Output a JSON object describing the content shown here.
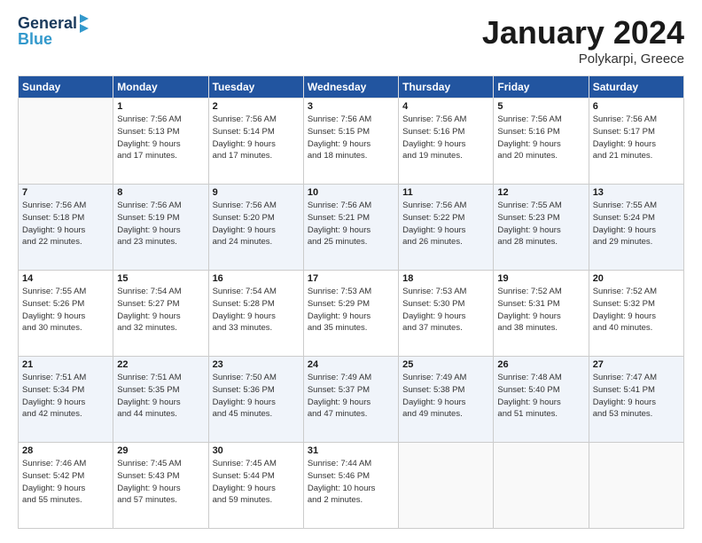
{
  "header": {
    "logo_line1": "General",
    "logo_line2": "Blue",
    "month_title": "January 2024",
    "location": "Polykarpi, Greece"
  },
  "weekdays": [
    "Sunday",
    "Monday",
    "Tuesday",
    "Wednesday",
    "Thursday",
    "Friday",
    "Saturday"
  ],
  "weeks": [
    [
      {
        "day": "",
        "sunrise": "",
        "sunset": "",
        "daylight": ""
      },
      {
        "day": "1",
        "sunrise": "Sunrise: 7:56 AM",
        "sunset": "Sunset: 5:13 PM",
        "daylight": "Daylight: 9 hours and 17 minutes."
      },
      {
        "day": "2",
        "sunrise": "Sunrise: 7:56 AM",
        "sunset": "Sunset: 5:14 PM",
        "daylight": "Daylight: 9 hours and 17 minutes."
      },
      {
        "day": "3",
        "sunrise": "Sunrise: 7:56 AM",
        "sunset": "Sunset: 5:15 PM",
        "daylight": "Daylight: 9 hours and 18 minutes."
      },
      {
        "day": "4",
        "sunrise": "Sunrise: 7:56 AM",
        "sunset": "Sunset: 5:16 PM",
        "daylight": "Daylight: 9 hours and 19 minutes."
      },
      {
        "day": "5",
        "sunrise": "Sunrise: 7:56 AM",
        "sunset": "Sunset: 5:16 PM",
        "daylight": "Daylight: 9 hours and 20 minutes."
      },
      {
        "day": "6",
        "sunrise": "Sunrise: 7:56 AM",
        "sunset": "Sunset: 5:17 PM",
        "daylight": "Daylight: 9 hours and 21 minutes."
      }
    ],
    [
      {
        "day": "7",
        "sunrise": "Sunrise: 7:56 AM",
        "sunset": "Sunset: 5:18 PM",
        "daylight": "Daylight: 9 hours and 22 minutes."
      },
      {
        "day": "8",
        "sunrise": "Sunrise: 7:56 AM",
        "sunset": "Sunset: 5:19 PM",
        "daylight": "Daylight: 9 hours and 23 minutes."
      },
      {
        "day": "9",
        "sunrise": "Sunrise: 7:56 AM",
        "sunset": "Sunset: 5:20 PM",
        "daylight": "Daylight: 9 hours and 24 minutes."
      },
      {
        "day": "10",
        "sunrise": "Sunrise: 7:56 AM",
        "sunset": "Sunset: 5:21 PM",
        "daylight": "Daylight: 9 hours and 25 minutes."
      },
      {
        "day": "11",
        "sunrise": "Sunrise: 7:56 AM",
        "sunset": "Sunset: 5:22 PM",
        "daylight": "Daylight: 9 hours and 26 minutes."
      },
      {
        "day": "12",
        "sunrise": "Sunrise: 7:55 AM",
        "sunset": "Sunset: 5:23 PM",
        "daylight": "Daylight: 9 hours and 28 minutes."
      },
      {
        "day": "13",
        "sunrise": "Sunrise: 7:55 AM",
        "sunset": "Sunset: 5:24 PM",
        "daylight": "Daylight: 9 hours and 29 minutes."
      }
    ],
    [
      {
        "day": "14",
        "sunrise": "Sunrise: 7:55 AM",
        "sunset": "Sunset: 5:26 PM",
        "daylight": "Daylight: 9 hours and 30 minutes."
      },
      {
        "day": "15",
        "sunrise": "Sunrise: 7:54 AM",
        "sunset": "Sunset: 5:27 PM",
        "daylight": "Daylight: 9 hours and 32 minutes."
      },
      {
        "day": "16",
        "sunrise": "Sunrise: 7:54 AM",
        "sunset": "Sunset: 5:28 PM",
        "daylight": "Daylight: 9 hours and 33 minutes."
      },
      {
        "day": "17",
        "sunrise": "Sunrise: 7:53 AM",
        "sunset": "Sunset: 5:29 PM",
        "daylight": "Daylight: 9 hours and 35 minutes."
      },
      {
        "day": "18",
        "sunrise": "Sunrise: 7:53 AM",
        "sunset": "Sunset: 5:30 PM",
        "daylight": "Daylight: 9 hours and 37 minutes."
      },
      {
        "day": "19",
        "sunrise": "Sunrise: 7:52 AM",
        "sunset": "Sunset: 5:31 PM",
        "daylight": "Daylight: 9 hours and 38 minutes."
      },
      {
        "day": "20",
        "sunrise": "Sunrise: 7:52 AM",
        "sunset": "Sunset: 5:32 PM",
        "daylight": "Daylight: 9 hours and 40 minutes."
      }
    ],
    [
      {
        "day": "21",
        "sunrise": "Sunrise: 7:51 AM",
        "sunset": "Sunset: 5:34 PM",
        "daylight": "Daylight: 9 hours and 42 minutes."
      },
      {
        "day": "22",
        "sunrise": "Sunrise: 7:51 AM",
        "sunset": "Sunset: 5:35 PM",
        "daylight": "Daylight: 9 hours and 44 minutes."
      },
      {
        "day": "23",
        "sunrise": "Sunrise: 7:50 AM",
        "sunset": "Sunset: 5:36 PM",
        "daylight": "Daylight: 9 hours and 45 minutes."
      },
      {
        "day": "24",
        "sunrise": "Sunrise: 7:49 AM",
        "sunset": "Sunset: 5:37 PM",
        "daylight": "Daylight: 9 hours and 47 minutes."
      },
      {
        "day": "25",
        "sunrise": "Sunrise: 7:49 AM",
        "sunset": "Sunset: 5:38 PM",
        "daylight": "Daylight: 9 hours and 49 minutes."
      },
      {
        "day": "26",
        "sunrise": "Sunrise: 7:48 AM",
        "sunset": "Sunset: 5:40 PM",
        "daylight": "Daylight: 9 hours and 51 minutes."
      },
      {
        "day": "27",
        "sunrise": "Sunrise: 7:47 AM",
        "sunset": "Sunset: 5:41 PM",
        "daylight": "Daylight: 9 hours and 53 minutes."
      }
    ],
    [
      {
        "day": "28",
        "sunrise": "Sunrise: 7:46 AM",
        "sunset": "Sunset: 5:42 PM",
        "daylight": "Daylight: 9 hours and 55 minutes."
      },
      {
        "day": "29",
        "sunrise": "Sunrise: 7:45 AM",
        "sunset": "Sunset: 5:43 PM",
        "daylight": "Daylight: 9 hours and 57 minutes."
      },
      {
        "day": "30",
        "sunrise": "Sunrise: 7:45 AM",
        "sunset": "Sunset: 5:44 PM",
        "daylight": "Daylight: 9 hours and 59 minutes."
      },
      {
        "day": "31",
        "sunrise": "Sunrise: 7:44 AM",
        "sunset": "Sunset: 5:46 PM",
        "daylight": "Daylight: 10 hours and 2 minutes."
      },
      {
        "day": "",
        "sunrise": "",
        "sunset": "",
        "daylight": ""
      },
      {
        "day": "",
        "sunrise": "",
        "sunset": "",
        "daylight": ""
      },
      {
        "day": "",
        "sunrise": "",
        "sunset": "",
        "daylight": ""
      }
    ]
  ]
}
